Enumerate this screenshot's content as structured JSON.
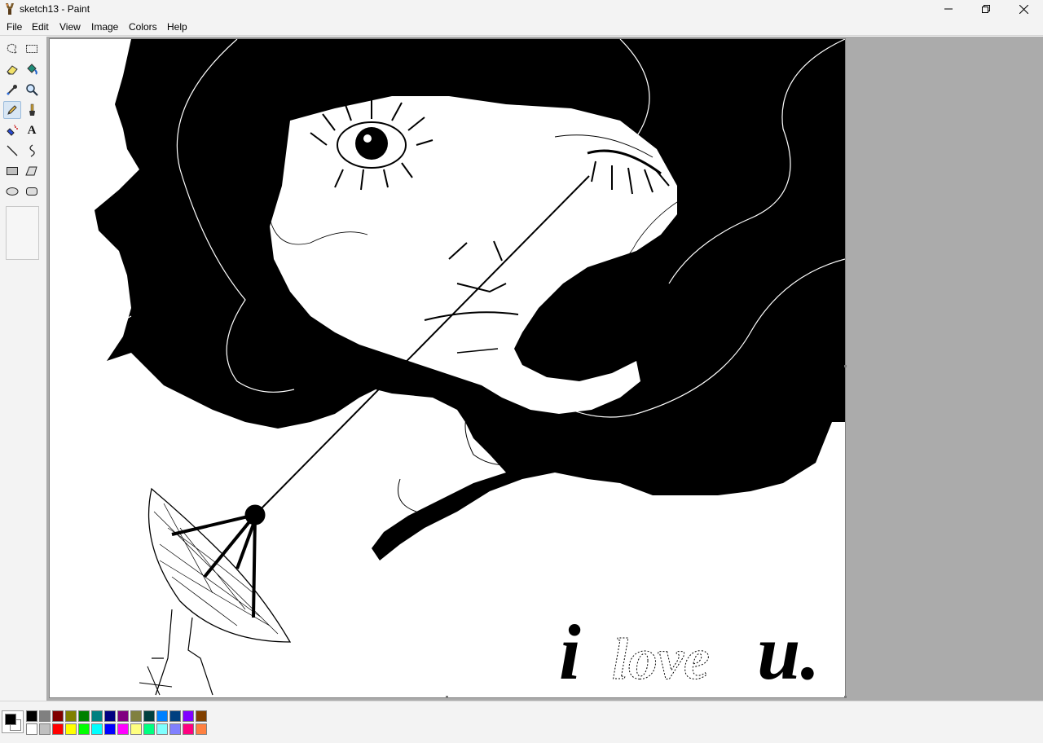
{
  "window": {
    "title": "sketch13 - Paint"
  },
  "menu": {
    "items": [
      "File",
      "Edit",
      "View",
      "Image",
      "Colors",
      "Help"
    ]
  },
  "toolbox": {
    "tools": [
      {
        "name": "free-form-select",
        "active": false
      },
      {
        "name": "select",
        "active": false
      },
      {
        "name": "eraser",
        "active": false
      },
      {
        "name": "fill-with-color",
        "active": false
      },
      {
        "name": "pick-color",
        "active": false
      },
      {
        "name": "magnifier",
        "active": false
      },
      {
        "name": "pencil",
        "active": true
      },
      {
        "name": "brush",
        "active": false
      },
      {
        "name": "airbrush",
        "active": false
      },
      {
        "name": "text",
        "active": false
      },
      {
        "name": "line",
        "active": false
      },
      {
        "name": "curve",
        "active": false
      },
      {
        "name": "rectangle",
        "active": false
      },
      {
        "name": "polygon",
        "active": false
      },
      {
        "name": "ellipse",
        "active": false
      },
      {
        "name": "rounded-rectangle",
        "active": false
      }
    ],
    "text_tool_glyph": "A"
  },
  "canvas": {
    "text": {
      "i": "i",
      "love": "love",
      "u": "u."
    }
  },
  "palette": {
    "foreground": "#000000",
    "background": "#ffffff",
    "colors": [
      "#000000",
      "#808080",
      "#800000",
      "#808000",
      "#008000",
      "#008080",
      "#000080",
      "#800080",
      "#808040",
      "#004040",
      "#0080ff",
      "#004080",
      "#8000ff",
      "#804000",
      "#ffffff",
      "#c0c0c0",
      "#ff0000",
      "#ffff00",
      "#00ff00",
      "#00ffff",
      "#0000ff",
      "#ff00ff",
      "#ffff80",
      "#00ff80",
      "#80ffff",
      "#8080ff",
      "#ff0080",
      "#ff8040"
    ]
  }
}
